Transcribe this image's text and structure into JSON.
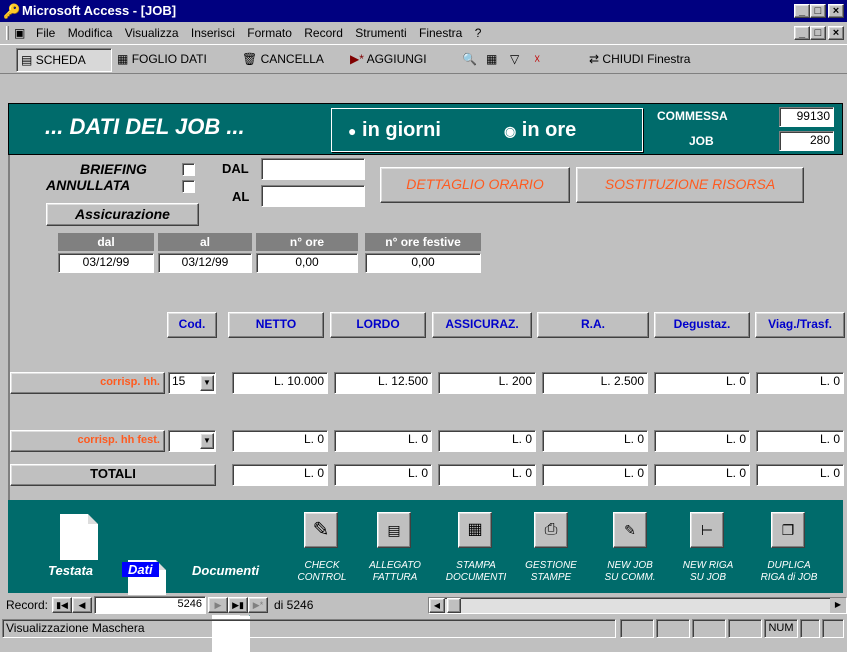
{
  "window": {
    "title": "Microsoft Access - [JOB]",
    "min": "_",
    "max": "□",
    "close": "×"
  },
  "menu": [
    "File",
    "Modifica",
    "Visualizza",
    "Inserisci",
    "Formato",
    "Record",
    "Strumenti",
    "Finestra",
    "?"
  ],
  "toolbar": {
    "scheda": "SCHEDA",
    "foglio": "FOGLIO DATI",
    "cancella": "CANCELLA",
    "aggiungi": "AGGIUNGI",
    "chiudi": "CHIUDI Finestra"
  },
  "header": {
    "title": "... DATI DEL JOB ...",
    "opt_giorni": "in giorni",
    "opt_ore": "in ore",
    "commessa_label": "COMMESSA",
    "commessa_value": "99130",
    "job_label": "JOB",
    "job_value": "280"
  },
  "body": {
    "briefing": "BRIEFING",
    "annullata": "ANNULLATA",
    "assicurazione": "Assicurazione",
    "dal": "DAL",
    "al": "AL",
    "dettaglio": "DETTAGLIO ORARIO",
    "sostituzione": "SOSTITUZIONE RISORSA",
    "period_headers": [
      "dal",
      "al",
      "n° ore",
      "n° ore festive"
    ],
    "period_values": [
      "03/12/99",
      "03/12/99",
      "0,00",
      "0,00"
    ],
    "col_headers": [
      "Cod.",
      "NETTO",
      "LORDO",
      "ASSICURAZ.",
      "R.A.",
      "Degustaz.",
      "Viag./Trasf."
    ],
    "row1_label": "corrisp. hh.",
    "row1_cod": "15",
    "row1_values": [
      "L. 10.000",
      "L. 12.500",
      "L. 200",
      "L. 2.500",
      "L. 0",
      "L. 0"
    ],
    "row2_label": "corrisp. hh fest.",
    "row2_cod": "",
    "row2_values": [
      "L. 0",
      "L. 0",
      "L. 0",
      "L. 0",
      "L. 0",
      "L. 0"
    ],
    "totali_label": "TOTALI",
    "totali_values": [
      "L. 0",
      "L. 0",
      "L. 0",
      "L. 0",
      "L. 0",
      "L. 0"
    ]
  },
  "footer": {
    "testata": "Testata",
    "dati": "Dati",
    "documenti": "Documenti",
    "buttons": [
      [
        "CHECK",
        "CONTROL"
      ],
      [
        "ALLEGATO",
        "FATTURA"
      ],
      [
        "STAMPA",
        "DOCUMENTI"
      ],
      [
        "GESTIONE",
        "STAMPE"
      ],
      [
        "NEW JOB",
        "SU COMM."
      ],
      [
        "NEW RIGA",
        "SU JOB"
      ],
      [
        "DUPLICA",
        "RIGA di JOB"
      ]
    ]
  },
  "record": {
    "label": "Record:",
    "current": "5246",
    "total": "di 5246"
  },
  "status": {
    "text": "Visualizzazione Maschera",
    "num": "NUM"
  },
  "colors": {
    "teal": "#006b6b",
    "orange": "#ff5a1f",
    "blue": "#0000cc",
    "title": "#000080"
  }
}
